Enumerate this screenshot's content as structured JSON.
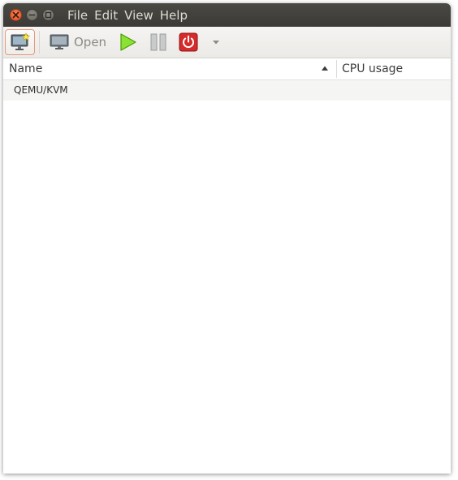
{
  "menubar": {
    "items": [
      {
        "label": "File"
      },
      {
        "label": "Edit"
      },
      {
        "label": "View"
      },
      {
        "label": "Help"
      }
    ]
  },
  "toolbar": {
    "open_label": "Open"
  },
  "table": {
    "columns": [
      {
        "label": "Name",
        "sort": "ascending"
      },
      {
        "label": "CPU usage"
      }
    ],
    "rows": [
      {
        "name": "QEMU/KVM"
      }
    ]
  },
  "colors": {
    "titlebar": "#3c3b37",
    "close": "#e95420",
    "run": "#73d216",
    "shutdown": "#cc2626"
  },
  "icons": {
    "new": "new-vm-monitor-icon",
    "open": "monitor-icon",
    "run": "play-icon",
    "pause": "pause-icon",
    "shutdown": "power-icon",
    "dropdown": "chevron-down-icon"
  }
}
